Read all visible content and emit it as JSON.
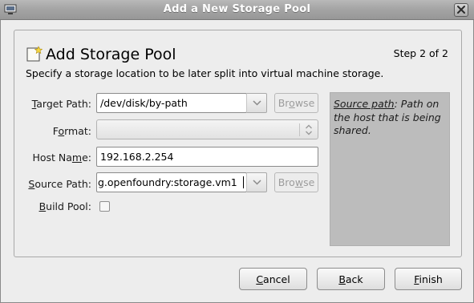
{
  "window": {
    "title": "Add a New Storage Pool",
    "app_icon": "computer-icon",
    "close_icon": "close-icon"
  },
  "header": {
    "icon": "new-storage-pool-icon",
    "heading": "Add Storage Pool",
    "step": "Step 2 of 2",
    "description": "Specify a storage location to be later split into virtual machine storage."
  },
  "form": {
    "target_path": {
      "label_pre": "",
      "label_mnemonic": "T",
      "label_post": "arget Path:",
      "value": "/dev/disk/by-path",
      "browse_pre": "Br",
      "browse_mnemonic": "o",
      "browse_post": "wse"
    },
    "format": {
      "label_pre": "F",
      "label_mnemonic": "o",
      "label_post": "rmat:",
      "value": ""
    },
    "host_name": {
      "label_pre": "Host Na",
      "label_mnemonic": "m",
      "label_post": "e:",
      "value": "192.168.2.254"
    },
    "source_path": {
      "label_pre": "",
      "label_mnemonic": "S",
      "label_post": "ource Path:",
      "value": "g.openfoundry:storage.vm1",
      "browse_pre": "Bro",
      "browse_mnemonic": "w",
      "browse_post": "se"
    },
    "build_pool": {
      "label_pre": "",
      "label_mnemonic": "B",
      "label_post": "uild Pool:",
      "checked": false
    }
  },
  "help": {
    "term": "Source path",
    "text": ": Path on the host that is being shared."
  },
  "buttons": {
    "cancel": {
      "pre": "",
      "mnemonic": "C",
      "post": "ancel"
    },
    "back": {
      "pre": "",
      "mnemonic": "B",
      "post": "ack"
    },
    "finish": {
      "pre": "",
      "mnemonic": "F",
      "post": "inish"
    }
  },
  "colors": {
    "titlebar": "#a5a5a5",
    "dialog_bg": "#ededed",
    "help_bg": "#bcbcbc",
    "disabled_text": "#9c9c9c"
  }
}
